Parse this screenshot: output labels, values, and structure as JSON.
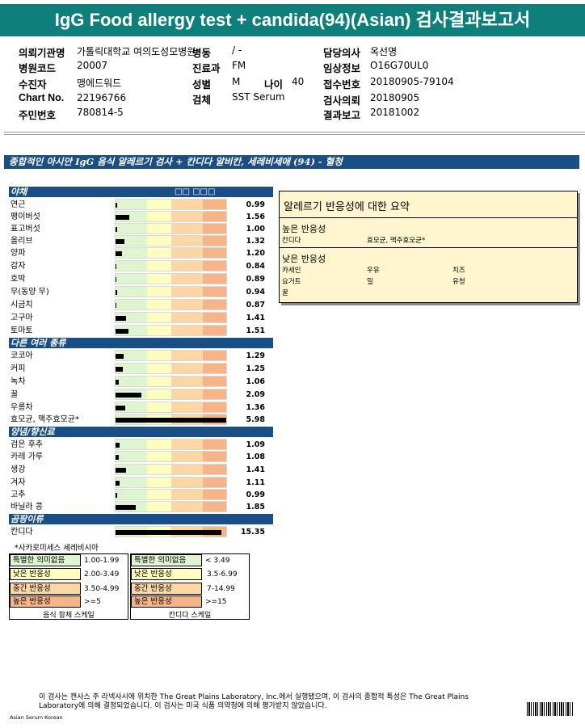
{
  "report": {
    "title": "IgG Food allergy test + candida(94)(Asian) 검사결과보고서",
    "banner": "종합적인 아시안 IgG 음식 알레르기 검사 + 칸디다 알비칸, 세레비세애 (94) - 혈청",
    "note": "*사카로미세스 세레비시아",
    "footer": "이 검사는 캔사스 주 라넥사시에 위치한 The Great Plains Laboratory, Inc.에서 실행됐으며, 이 검사의 종합적 특성은 The Great Plains Laboratory에 의해 결정되었습니다. 이 검사는 미국 식품 의약청에 의해 평가받지 않았습니다.",
    "bottom_label": "Asian Serum Korean"
  },
  "patient": {
    "institution_label": "의뢰기관명",
    "institution": "가톨릭대학교 여의도성모병원",
    "ward_label": "병동",
    "ward": "/ -",
    "doctor_label": "담당의사",
    "doctor": "옥선명",
    "hospital_code_label": "병원코드",
    "hospital_code": "20007",
    "dept_label": "진료과",
    "dept": "FM",
    "clinical_label": "임상정보",
    "clinical": "O16G70UL0",
    "recipient_label": "수진자",
    "recipient": "맹에드워드",
    "sex_label": "성별",
    "sex": "M",
    "age_label": "나이",
    "age": "40",
    "receipt_label": "접수번호",
    "receipt": "20180905-79104",
    "chart_label": "Chart No.",
    "chart": "22196766",
    "specimen_label": "검체",
    "specimen": "SST Serum",
    "request_label": "검사의뢰",
    "request": "20180905",
    "rrn_label": "주민번호",
    "rrn": "780814-5",
    "result_label": "결과보고",
    "result": "20181002"
  },
  "categories": [
    {
      "name": "야채",
      "sub": "□□ □□□",
      "items": [
        {
          "name": "연근",
          "value": "0.99"
        },
        {
          "name": "팽이버섯",
          "value": "1.56"
        },
        {
          "name": "표고버섯",
          "value": "1.00"
        },
        {
          "name": "올리브",
          "value": "1.32"
        },
        {
          "name": "양파",
          "value": "1.20"
        },
        {
          "name": "감자",
          "value": "0.84"
        },
        {
          "name": "호박",
          "value": "0.89"
        },
        {
          "name": "무(동양 무)",
          "value": "0.94"
        },
        {
          "name": "시금치",
          "value": "0.87"
        },
        {
          "name": "고구마",
          "value": "1.41"
        },
        {
          "name": "토마토",
          "value": "1.51"
        }
      ]
    },
    {
      "name": "다른 여러 종류",
      "items": [
        {
          "name": "코코아",
          "value": "1.29"
        },
        {
          "name": "커피",
          "value": "1.25"
        },
        {
          "name": "녹차",
          "value": "1.06"
        },
        {
          "name": "꿀",
          "value": "2.09"
        },
        {
          "name": "우롱차",
          "value": "1.36"
        },
        {
          "name": "효모균, 맥주효모균*",
          "value": "5.98"
        }
      ]
    },
    {
      "name": "양념/향신료",
      "items": [
        {
          "name": "검은 후추",
          "value": "1.09"
        },
        {
          "name": "카레 가루",
          "value": "1.08"
        },
        {
          "name": "생강",
          "value": "1.41"
        },
        {
          "name": "겨자",
          "value": "1.11"
        },
        {
          "name": "고추",
          "value": "0.99"
        },
        {
          "name": "바닐라 콩",
          "value": "1.85"
        }
      ]
    },
    {
      "name": "곰팡이류",
      "items": [
        {
          "name": "칸디다",
          "value": "15.35"
        }
      ]
    }
  ],
  "summary": {
    "title": "알레르기 반응성에 대한 요약",
    "high_label": "높은 반응성",
    "high_items": [
      "칸디다",
      "효모균, 맥주효모균*"
    ],
    "low_label": "낮은 반응성",
    "low_items": [
      "카세인",
      "우유",
      "치즈",
      "요거트",
      "밀",
      "유청",
      "꿀"
    ]
  },
  "legend_food": {
    "caption": "음식 항체 스케일",
    "rows": [
      {
        "label": "특별한 의미없음",
        "range": "1.00-1.99",
        "color": "#dff5cf"
      },
      {
        "label": "낮은 반응성",
        "range": "2.00-3.49",
        "color": "#fdfdc0"
      },
      {
        "label": "중간 반응성",
        "range": "3.50-4.99",
        "color": "#fcd7a4"
      },
      {
        "label": "높은 반응성",
        "range": ">=5",
        "color": "#f6b489"
      }
    ]
  },
  "legend_candida": {
    "caption": "칸디다 스케일",
    "rows": [
      {
        "label": "특별한 의미없음",
        "range": "< 3.49",
        "color": "#dff5cf"
      },
      {
        "label": "낮은 반응성",
        "range": "3.5-6.99",
        "color": "#fdfdc0"
      },
      {
        "label": "중간 반응성",
        "range": "7-14.99",
        "color": "#fcd7a4"
      },
      {
        "label": "높은 반응성",
        "range": ">=15",
        "color": "#f6b489"
      }
    ]
  }
}
